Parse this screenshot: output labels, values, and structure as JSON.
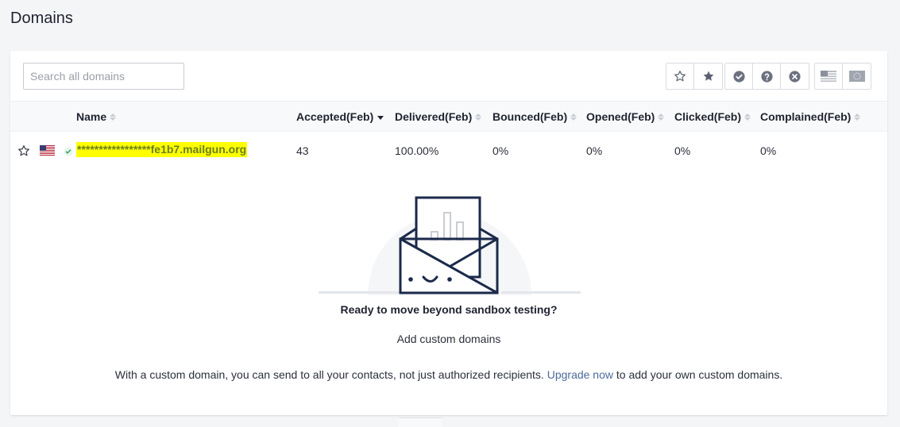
{
  "page": {
    "title": "Domains"
  },
  "search": {
    "placeholder": "Search all domains",
    "value": ""
  },
  "filters": {
    "favorites": [
      "star-outline-icon",
      "star-filled-icon"
    ],
    "status": [
      "check-circle-icon",
      "question-circle-icon",
      "x-circle-icon"
    ],
    "region": [
      "us-flag-icon",
      "eu-flag-icon"
    ]
  },
  "table": {
    "columns": {
      "name": "Name",
      "accepted": "Accepted(Feb)",
      "delivered": "Delivered(Feb)",
      "bounced": "Bounced(Feb)",
      "opened": "Opened(Feb)",
      "clicked": "Clicked(Feb)",
      "complained": "Complained(Feb)"
    },
    "sorted_by": "accepted",
    "sort_direction": "desc",
    "rows": [
      {
        "domain": "*****************fe1b7.mailgun.org",
        "accepted": "43",
        "delivered": "100.00%",
        "bounced": "0%",
        "opened": "0%",
        "clicked": "0%",
        "complained": "0%",
        "status": "verified",
        "region": "us"
      }
    ]
  },
  "empty_state": {
    "title": "Ready to move beyond sandbox testing?",
    "link": "Add custom domains",
    "text_before": "With a custom domain, you can send to all your contacts, not just authorized recipients. ",
    "upgrade_link": "Upgrade now",
    "text_after": " to add your own custom domains."
  },
  "colors": {
    "highlight": "#ffff00",
    "domain_text": "#6b7f1e",
    "verified": "#2ea55b",
    "illustration_stroke": "#1b2a4a"
  }
}
